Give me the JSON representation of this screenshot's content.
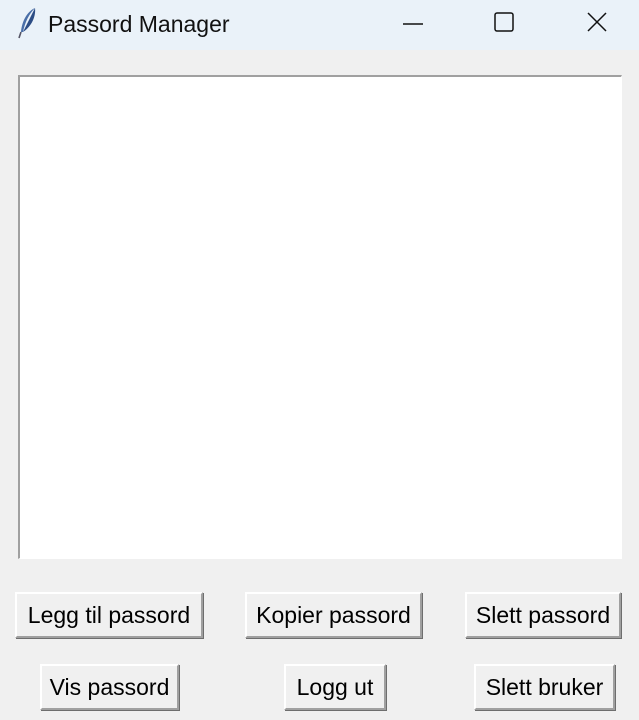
{
  "window": {
    "title": "Passord Manager",
    "icon": "feather-icon",
    "controls": [
      "minimize-icon",
      "maximize-icon",
      "close-icon"
    ]
  },
  "listbox": {
    "items": []
  },
  "buttons": {
    "add_password": "Legg til passord",
    "copy_password": "Kopier passord",
    "delete_password": "Slett passord",
    "show_password": "Vis passord",
    "log_out": "Logg ut",
    "delete_user": "Slett bruker"
  },
  "colors": {
    "titlebar_bg": "#eaf2f9",
    "window_bg": "#f0f0f0",
    "listbox_bg": "#ffffff"
  }
}
